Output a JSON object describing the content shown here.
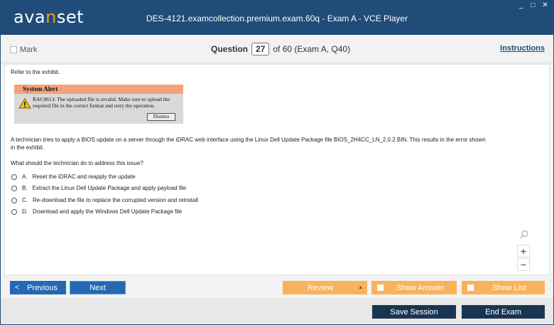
{
  "app": {
    "logo_prefix": "ava",
    "logo_accent": "n",
    "logo_suffix": "set",
    "window_title": "DES-4121.examcollection.premium.exam.60q - Exam A - VCE Player"
  },
  "question_bar": {
    "mark_label": "Mark",
    "question_label": "Question",
    "question_number": "27",
    "question_of": "of 60 (Exam A, Q40)",
    "instructions_label": "Instructions"
  },
  "question": {
    "intro": "Refer to the exhibit.",
    "exhibit": {
      "title": "System Alert",
      "line1": "RAC0613: The uploaded file is invalid. Make sure to upload the",
      "line2": "required file in the correct format and retry the operation.",
      "dismiss": "Dismiss"
    },
    "body_line1": "A technician tries to apply a BIOS update on a server through the iDRAC web interface using the Linux Dell Update Package file BIOS_2H4CC_LN_2.0.2.BIN. This results in the error shown",
    "body_line2": "in the exhibit.",
    "prompt": "What should the technician do to address this issue?",
    "options": [
      {
        "letter": "A.",
        "text": "Reset the iDRAC and reapply the update"
      },
      {
        "letter": "B.",
        "text": "Extract the Linux Dell Update Package and apply payload file"
      },
      {
        "letter": "C.",
        "text": "Re-download the file to replace the corrupted version and reinstall"
      },
      {
        "letter": "D.",
        "text": "Download and apply the Windows Dell Update Package file"
      }
    ]
  },
  "zoom": {
    "plus": "+",
    "minus": "−"
  },
  "nav": {
    "previous": "Previous",
    "next": "Next",
    "review": "Review",
    "show_answer": "Show Answer",
    "show_list": "Show List",
    "save_session": "Save Session",
    "end_exam": "End Exam"
  },
  "colors": {
    "titlebar": "#1f4c78",
    "accent": "#f39c2a",
    "primary_button": "#2469b4",
    "orange_button": "#f9b25a",
    "dark_button": "#1a3552"
  }
}
